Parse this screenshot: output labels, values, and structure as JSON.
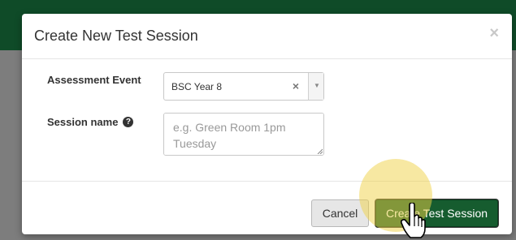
{
  "dialog": {
    "title": "Create New Test Session",
    "close_glyph": "×"
  },
  "form": {
    "assessment_event": {
      "label": "Assessment Event",
      "selected": "BSC Year 8",
      "clear_glyph": "×",
      "arrow_glyph": "▼"
    },
    "session_name": {
      "label": "Session name",
      "help_glyph": "?",
      "value": "",
      "placeholder": "e.g. Green Room 1pm Tuesday"
    }
  },
  "footer": {
    "cancel_label": "Cancel",
    "create_label": "Create Test Session"
  },
  "colors": {
    "header_bar": "#0f4b28",
    "primary_button": "#165c2f",
    "click_highlight": "#f0d246"
  },
  "icons": {
    "pointer": "hand-pointer-icon"
  }
}
